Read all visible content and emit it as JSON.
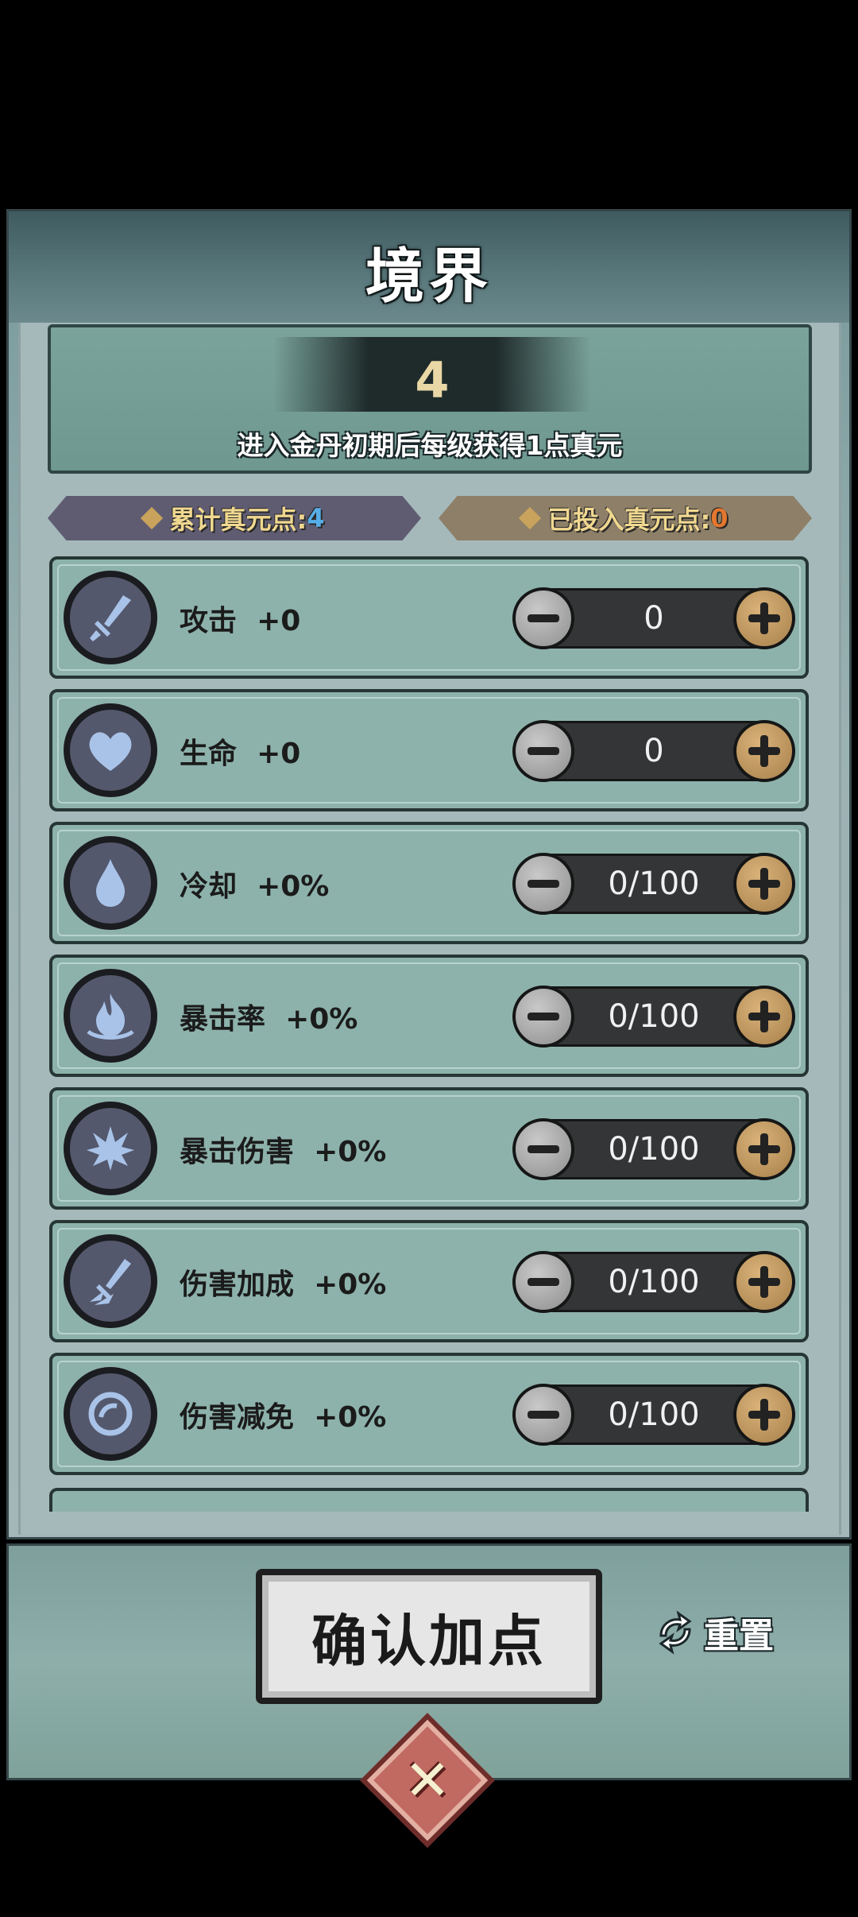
{
  "title": "境界",
  "level": "4",
  "info_text": "进入金丹初期后每级获得1点真元",
  "badges": {
    "total_label": "累计真元点:",
    "total_value": "4",
    "invested_label": "已投入真元点:",
    "invested_value": "0"
  },
  "stats": [
    {
      "name": "攻击",
      "bonus": "+0",
      "value": "0",
      "icon": "sword-icon"
    },
    {
      "name": "生命",
      "bonus": "+0",
      "value": "0",
      "icon": "heart-icon"
    },
    {
      "name": "冷却",
      "bonus": "+0%",
      "value": "0/100",
      "icon": "water-drop-icon"
    },
    {
      "name": "暴击率",
      "bonus": "+0%",
      "value": "0/100",
      "icon": "flame-icon"
    },
    {
      "name": "暴击伤害",
      "bonus": "+0%",
      "value": "0/100",
      "icon": "burst-icon"
    },
    {
      "name": "伤害加成",
      "bonus": "+0%",
      "value": "0/100",
      "icon": "sword-slash-icon"
    },
    {
      "name": "伤害减免",
      "bonus": "+0%",
      "value": "0/100",
      "icon": "shield-ring-icon"
    }
  ],
  "buttons": {
    "confirm": "确认加点",
    "reset": "重置"
  },
  "colors": {
    "accent_blue": "#56aee8",
    "accent_orange": "#e4762e",
    "gold": "#c9a35c"
  }
}
